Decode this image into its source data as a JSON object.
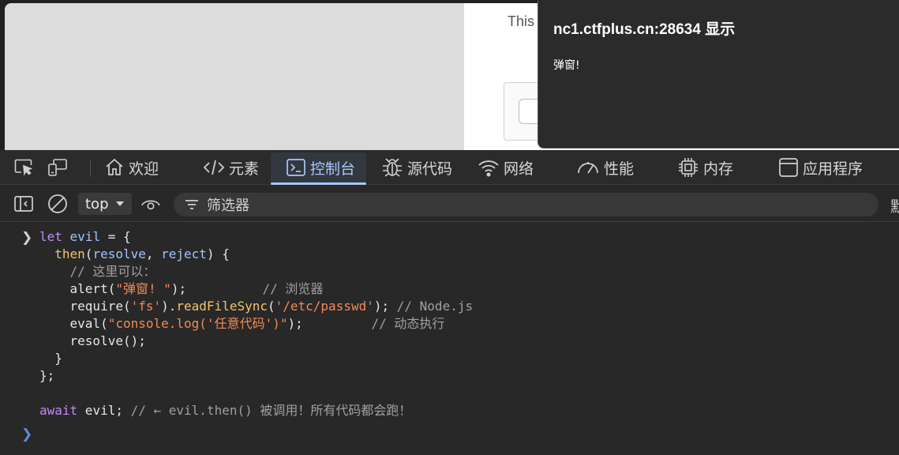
{
  "page": {
    "text_fragment": "This"
  },
  "alert": {
    "title": "nc1.ctfplus.cn:28634 显示",
    "message": "弹窗!"
  },
  "devtools": {
    "tabs": [
      {
        "label": "欢迎",
        "icon": "home-icon"
      },
      {
        "label": "元素",
        "icon": "code-icon"
      },
      {
        "label": "控制台",
        "icon": "console-icon",
        "active": true
      },
      {
        "label": "源代码",
        "icon": "bug-icon"
      },
      {
        "label": "网络",
        "icon": "wifi-icon"
      },
      {
        "label": "性能",
        "icon": "gauge-icon"
      },
      {
        "label": "内存",
        "icon": "chip-icon"
      },
      {
        "label": "应用程序",
        "icon": "window-icon"
      }
    ],
    "accent_color": "#a8c7fa"
  },
  "console_toolbar": {
    "context": "top",
    "filter_placeholder": "筛选器",
    "trailing": "默"
  },
  "console": {
    "lines": [
      "let evil = {",
      "  then(resolve, reject) {",
      "    // 这里可以：",
      "    alert(\"弹窗! \");          // 浏览器",
      "    require('fs').readFileSync('/etc/passwd'); // Node.js",
      "    eval(\"console.log('任意代码')\");         // 动态执行",
      "    resolve();",
      "  }",
      "};",
      "",
      "await evil; // ← evil.then() 被调用！所有代码都会跑！"
    ]
  }
}
